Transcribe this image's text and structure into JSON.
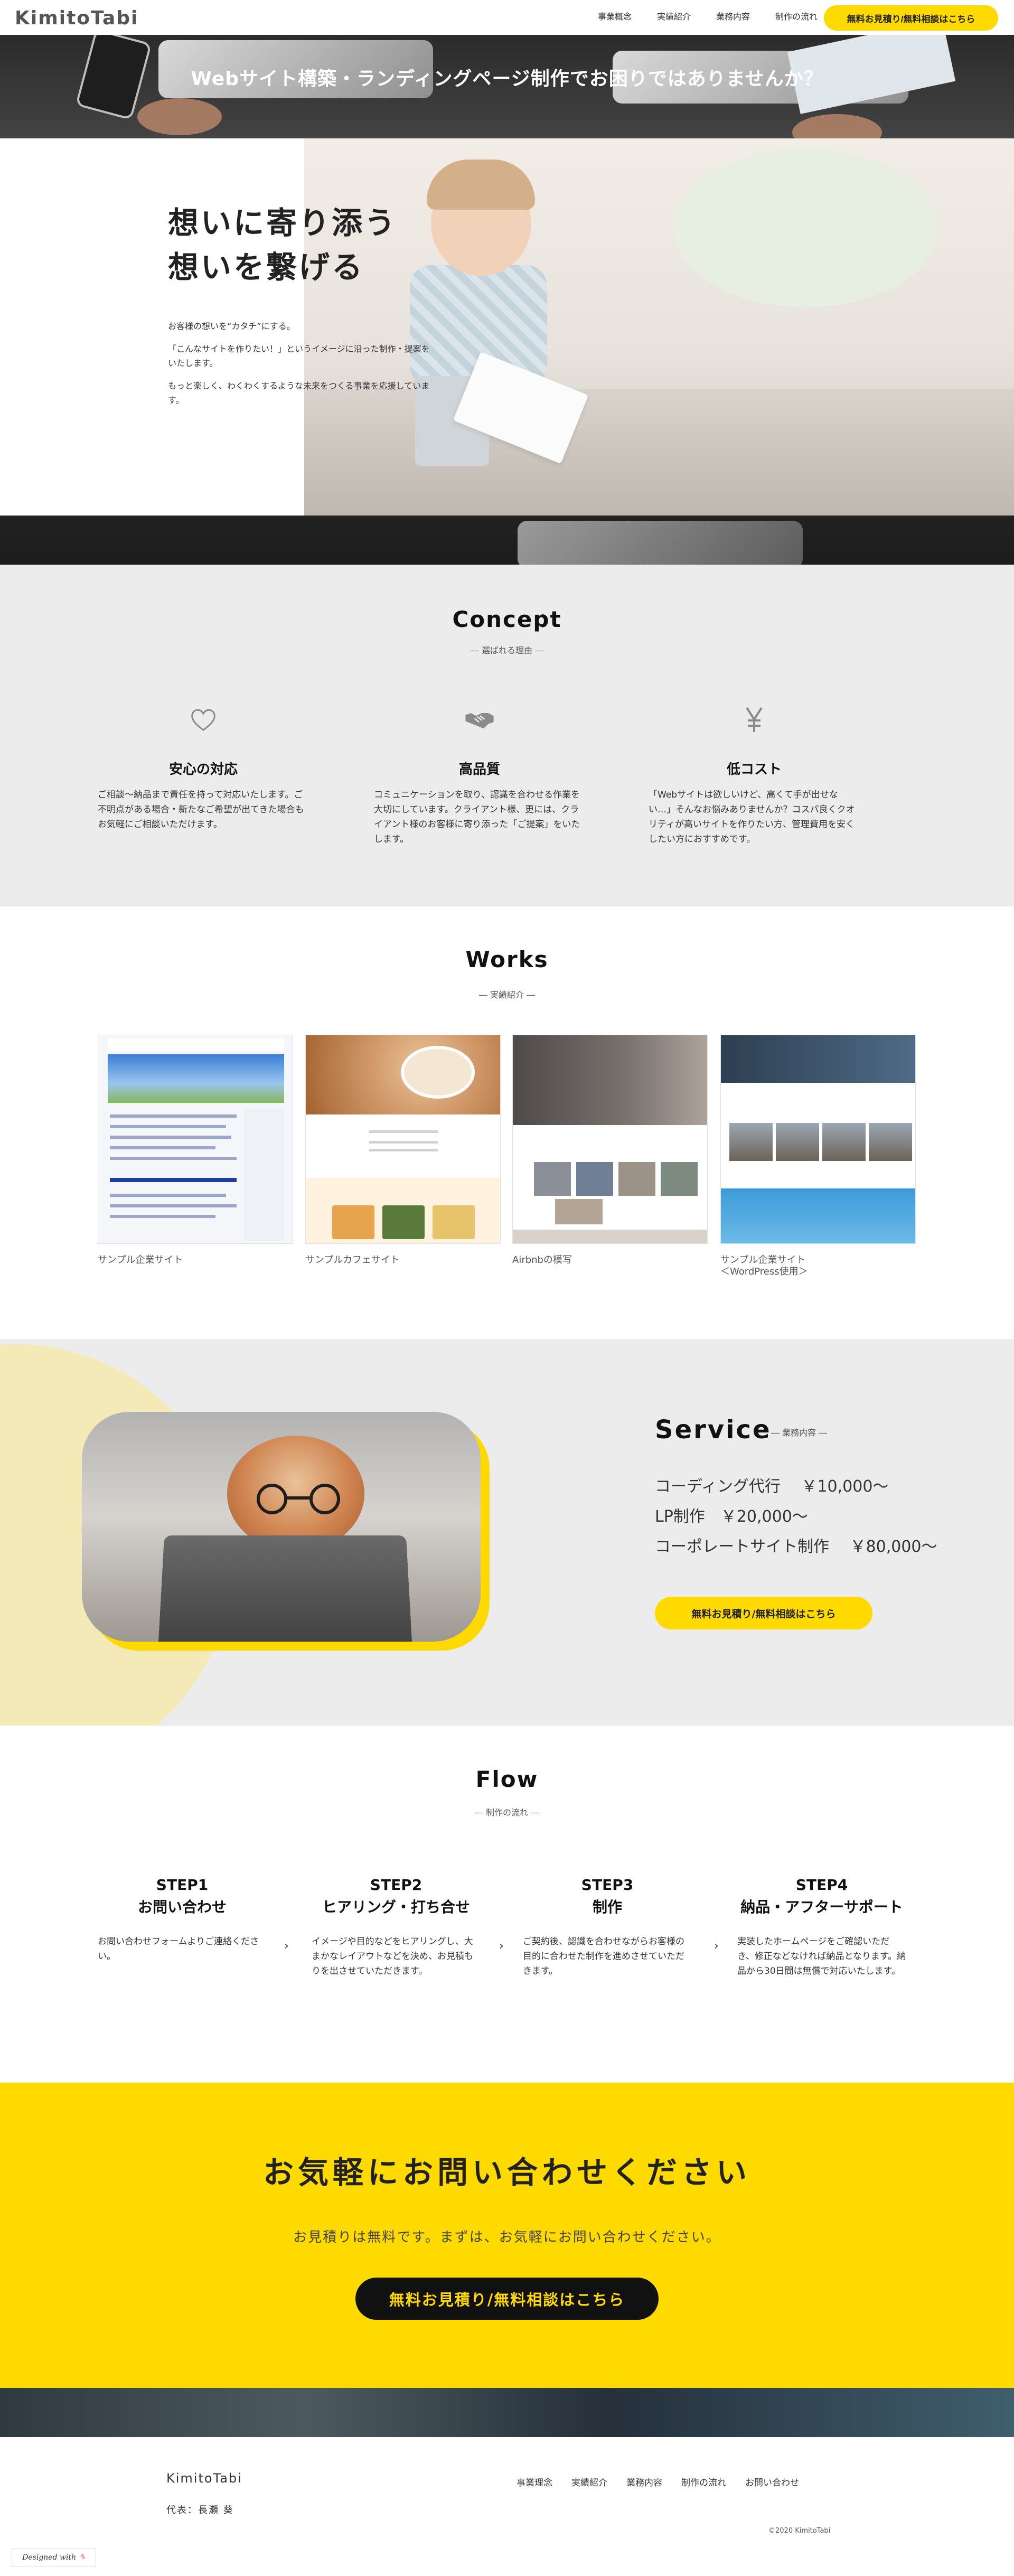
{
  "header": {
    "logo": "KimitoTabi",
    "nav": [
      "事業概念",
      "実績紹介",
      "業務内容",
      "制作の流れ"
    ],
    "cta_label": "無料お見積り/無料相談はこちら"
  },
  "hero": {
    "title": "Webサイト構築・ランディングページ制作でお困りではありませんか？",
    "heading_line1": "想いに寄り添う",
    "heading_line2": "想いを繋げる",
    "paragraphs": [
      "お客様の想いを“カタチ”にする。",
      "「こんなサイトを作りたい！」というイメージに沿った制作・提案をいたします。",
      "もっと楽しく、わくわくするような未来をつくる事業を応援しています。"
    ]
  },
  "concept": {
    "title": "Concept",
    "subtitle": "― 選ばれる理由 ―",
    "items": [
      {
        "icon": "heart-icon",
        "title": "安心の対応",
        "text": "ご相談〜納品まで責任を持って対応いたします。ご不明点がある場合・新たなご希望が出てきた場合もお気軽にご相談いただけます。"
      },
      {
        "icon": "handshake-icon",
        "title": "高品質",
        "text": "コミュニケーションを取り、認識を合わせる作業を大切にしています。クライアント様、更には、クライアント様のお客様に寄り添った「ご提案」をいたします。"
      },
      {
        "icon": "yen-icon",
        "title": "低コスト",
        "text": "「Webサイトは欲しいけど、高くて手が出せない…」そんなお悩みありませんか？コスパ良くクオリティが高いサイトを作りたい方、管理費用を安くしたい方におすすめです。"
      }
    ]
  },
  "works": {
    "title": "Works",
    "subtitle": "― 実績紹介 ―",
    "items": [
      {
        "caption": "サンプル企業サイト"
      },
      {
        "caption": "サンプルカフェサイト"
      },
      {
        "caption": "Airbnbの模写"
      },
      {
        "caption": "サンプル企業サイト",
        "caption2": "＜WordPress使用＞"
      }
    ]
  },
  "service": {
    "title": "Service",
    "subtitle": "― 業務内容 ―",
    "lines": [
      "コーディング代行　 ￥10,000〜",
      "LP制作　￥20,000〜",
      "コーポレートサイト制作　 ￥80,000〜"
    ],
    "cta_label": "無料お見積り/無料相談はこちら"
  },
  "flow": {
    "title": "Flow",
    "subtitle": "― 制作の流れ ―",
    "steps": [
      {
        "step": "STEP1",
        "title": "お問い合わせ",
        "text": "お問い合わせフォームよりご連絡ください。"
      },
      {
        "step": "STEP2",
        "title": "ヒアリング・打ち合せ",
        "text": "イメージや目的などをヒアリングし、大まかなレイアウトなどを決め、お見積もりを出させていただきます。"
      },
      {
        "step": "STEP3",
        "title": "制作",
        "text": "ご契約後、認識を合わせながらお客様の目的に合わせた制作を進めさせていただきます。"
      },
      {
        "step": "STEP4",
        "title": "納品・アフターサポート",
        "text": "実装したホームページをご確認いただき、修正などなければ納品となります。納品から30日間は無償で対応いたします。"
      }
    ]
  },
  "contact": {
    "title": "お気軽にお問い合わせください",
    "text": "お見積りは無料です。まずは、お気軽にお問い合わせください。",
    "cta_label": "無料お見積り/無料相談はこちら"
  },
  "footer": {
    "logo": "KimitoTabi",
    "representative": "代表：長瀬 葵",
    "nav": [
      "事業理念",
      "実績紹介",
      "業務内容",
      "制作の流れ",
      "お問い合わせ"
    ],
    "copyright": "©2020 KimitoTabi",
    "designed_with": "Designed with"
  },
  "colors": {
    "accent": "#ffda00",
    "section_gray": "#ececec",
    "text_dark": "#222222"
  }
}
